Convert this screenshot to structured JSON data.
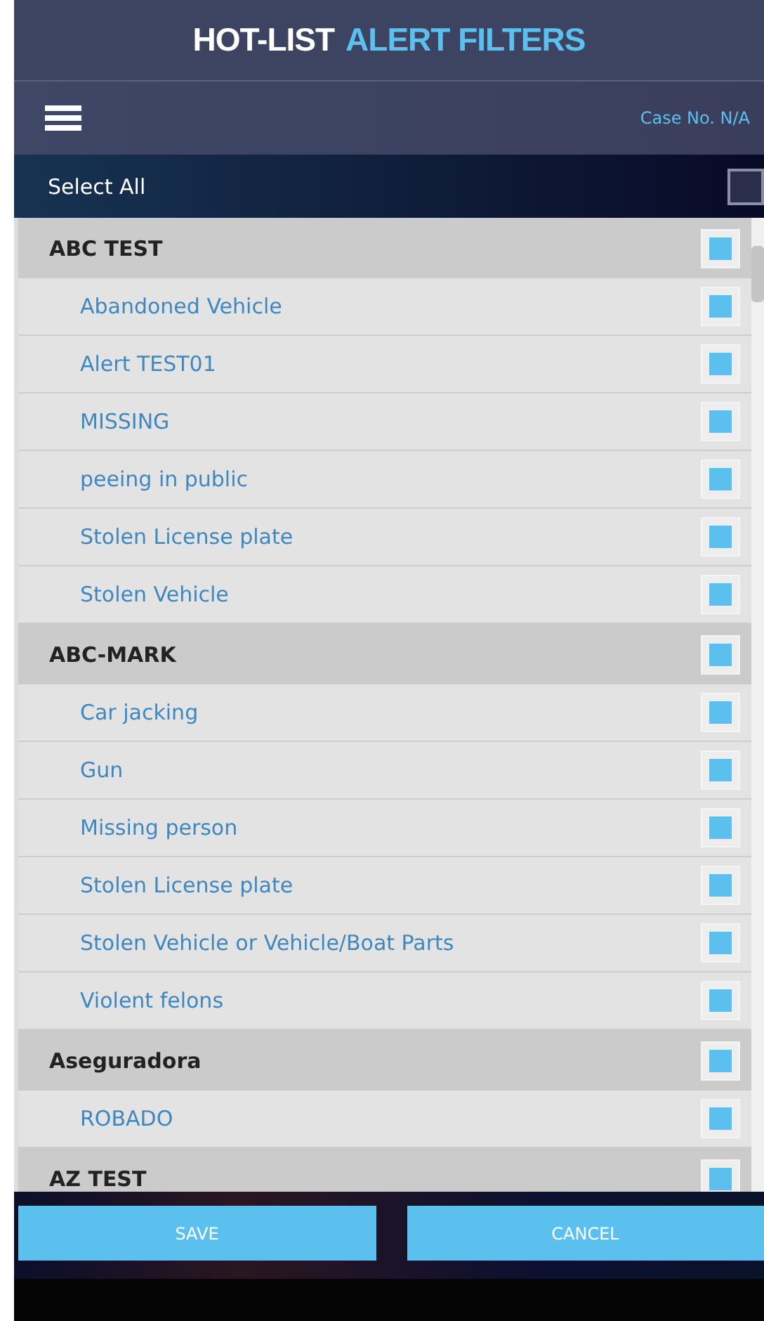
{
  "header": {
    "title_part_1": "HOT-LIST",
    "title_part_2": "ALERT FILTERS"
  },
  "toolbar": {
    "case_label": "Case No. N/A"
  },
  "select_all": {
    "label": "Select All",
    "checked": false
  },
  "groups": [
    {
      "name": "ABC TEST",
      "checked": true,
      "children": [
        {
          "label": "Abandoned Vehicle",
          "checked": true
        },
        {
          "label": "Alert TEST01",
          "checked": true
        },
        {
          "label": "MISSING",
          "checked": true
        },
        {
          "label": "peeing in public",
          "checked": true
        },
        {
          "label": "Stolen License plate",
          "checked": true
        },
        {
          "label": "Stolen Vehicle",
          "checked": true
        }
      ]
    },
    {
      "name": "ABC-MARK",
      "checked": true,
      "children": [
        {
          "label": "Car jacking",
          "checked": true
        },
        {
          "label": "Gun",
          "checked": true
        },
        {
          "label": "Missing person",
          "checked": true
        },
        {
          "label": "Stolen License plate",
          "checked": true
        },
        {
          "label": "Stolen Vehicle or Vehicle/Boat Parts",
          "checked": true
        },
        {
          "label": "Violent felons",
          "checked": true
        }
      ]
    },
    {
      "name": "Aseguradora",
      "checked": true,
      "children": [
        {
          "label": "ROBADO",
          "checked": true
        }
      ]
    },
    {
      "name": "AZ TEST",
      "checked": true
    }
  ],
  "buttons": [
    "SAVE",
    "CANCEL"
  ]
}
